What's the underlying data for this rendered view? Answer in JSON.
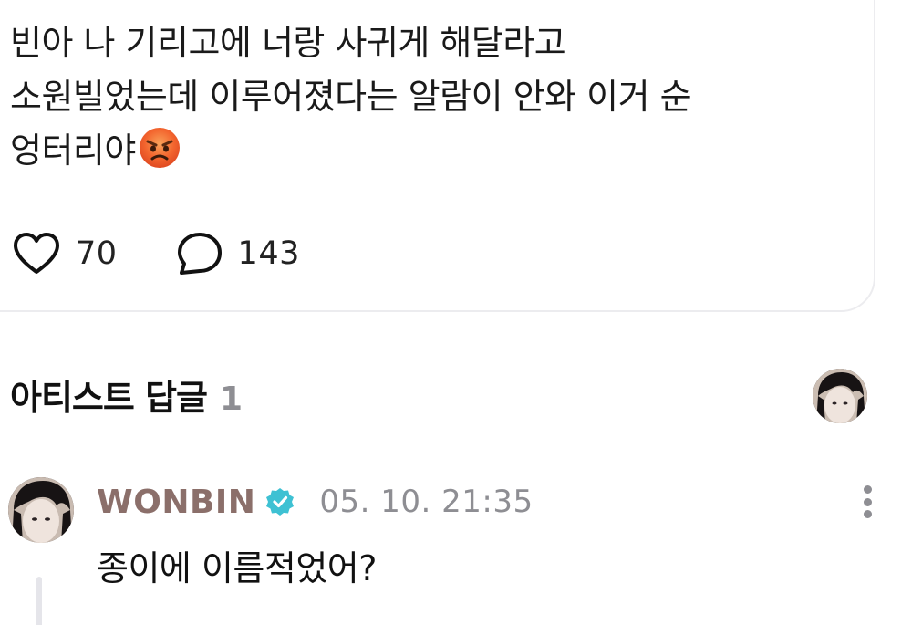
{
  "post": {
    "body": "빈아 나 기리고에 너랑 사귀게 해달라고\n소원빌었는데 이루어졌다는 알람이 안와 이거 순\n엉터리야",
    "emoji": "angry-face",
    "likes": "70",
    "comments": "143"
  },
  "artist_replies": {
    "title": "아티스트 답글",
    "count": "1"
  },
  "comment": {
    "author": "WONBIN",
    "verified": true,
    "timestamp": "05. 10. 21:35",
    "text": "종이에 이름적었어?"
  },
  "colors": {
    "author": "#8b6f6a",
    "verified_badge": "#3ec1d3",
    "muted": "#8e8e93",
    "card_border": "#ececef"
  },
  "icons": {
    "like": "heart-outline-icon",
    "comment": "speech-bubble-icon",
    "verified": "verified-badge-icon",
    "more": "more-vertical-icon"
  }
}
